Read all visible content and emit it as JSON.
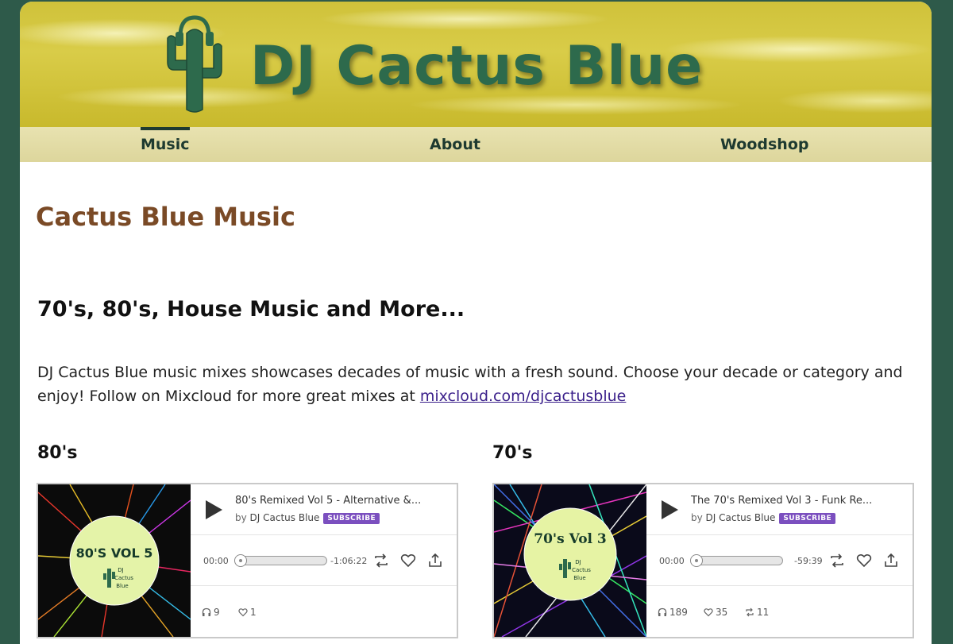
{
  "site": {
    "title": "DJ Cactus Blue"
  },
  "nav": [
    {
      "label": "Music",
      "active": true
    },
    {
      "label": "About",
      "active": false
    },
    {
      "label": "Woodshop",
      "active": false
    }
  ],
  "page": {
    "heading": "Cactus Blue Music",
    "section_heading": "70's, 80's, House Music and More...",
    "intro_text": "DJ Cactus Blue music mixes showcases decades of music with a fresh sound. Choose your decade or category and enjoy! Follow on Mixcloud for more great mixes at ",
    "intro_link": "mixcloud.com/djcactusblue"
  },
  "columns": [
    {
      "heading": "80's",
      "player": {
        "art_title": "80'S VOL 5",
        "art_logo_text": "DJ Cactus Blue",
        "title": "80's Remixed Vol 5 - Alternative &...",
        "by": "by",
        "artist": "DJ Cactus Blue",
        "subscribe_label": "SUBSCRIBE",
        "time_start": "00:00",
        "time_end": "-1:06:22",
        "plays": "9",
        "likes": "1",
        "reposts": null
      }
    },
    {
      "heading": "70's",
      "player": {
        "art_title": "70's Vol 3",
        "art_logo_text": "DJ Cactus Blue",
        "title": "The 70's Remixed Vol 3 - Funk Re...",
        "by": "by",
        "artist": "DJ Cactus Blue",
        "subscribe_label": "SUBSCRIBE",
        "time_start": "00:00",
        "time_end": "-59:39",
        "plays": "189",
        "likes": "35",
        "reposts": "11"
      }
    }
  ],
  "colors": {
    "background": "#2e5a4a",
    "banner": "#d4c640",
    "title_green": "#2d6a4c",
    "heading_brown": "#7a4a26",
    "subscribe_purple": "#7b4fbf"
  },
  "icons": {
    "play": "play-icon",
    "repost": "repost-icon",
    "like": "heart-icon",
    "share": "share-icon",
    "plays": "headphones-icon"
  }
}
